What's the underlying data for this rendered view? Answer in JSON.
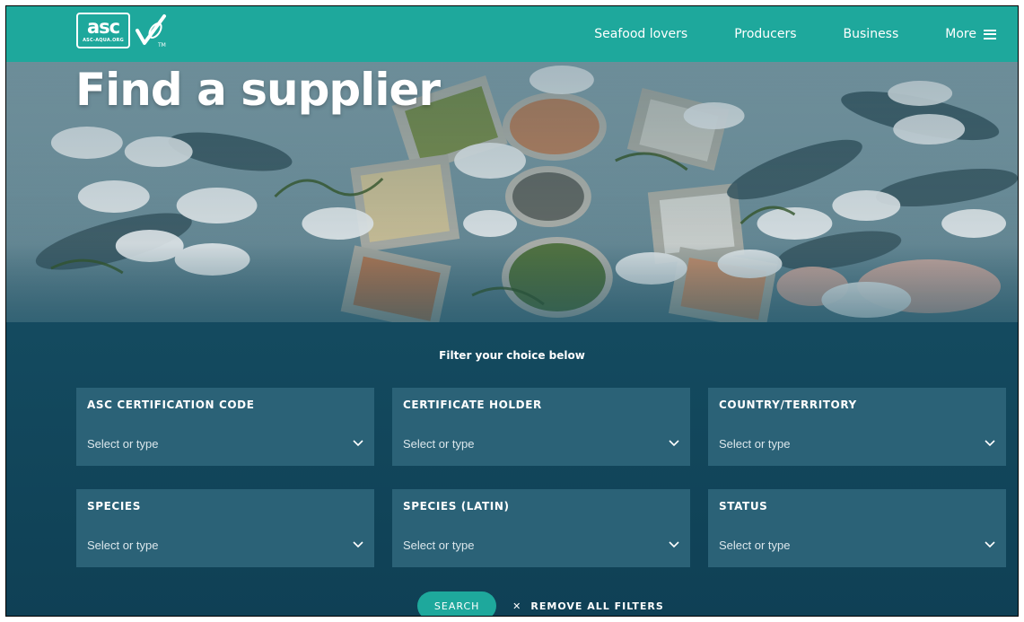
{
  "brand": {
    "logo_text": "asc",
    "logo_domain": "ASC-AQUA.ORG",
    "logo_tm": "TM"
  },
  "nav": {
    "items": [
      {
        "label": "Seafood lovers"
      },
      {
        "label": "Producers"
      },
      {
        "label": "Business"
      }
    ],
    "more_label": "More"
  },
  "hero": {
    "title": "Find a supplier"
  },
  "filters": {
    "heading": "Filter your choice below",
    "fields": [
      {
        "label": "ASC CERTIFICATION CODE",
        "placeholder": "Select or type"
      },
      {
        "label": "CERTIFICATE HOLDER",
        "placeholder": "Select or type"
      },
      {
        "label": "COUNTRY/TERRITORY",
        "placeholder": "Select or type"
      },
      {
        "label": "SPECIES",
        "placeholder": "Select or type"
      },
      {
        "label": "SPECIES (LATIN)",
        "placeholder": "Select or type"
      },
      {
        "label": "STATUS",
        "placeholder": "Select or type"
      }
    ]
  },
  "actions": {
    "search_label": "SEARCH",
    "remove_label": "REMOVE ALL FILTERS"
  },
  "colors": {
    "teal": "#1ea89c",
    "navy": "#154d62",
    "panel": "#2b6277"
  }
}
